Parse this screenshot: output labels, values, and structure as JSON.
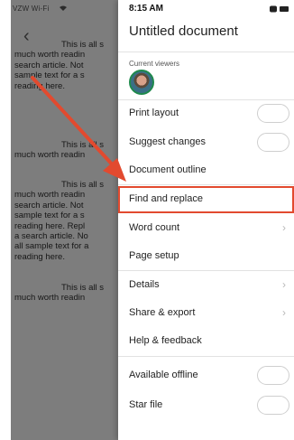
{
  "status": {
    "carrier": "VZW Wi-Fi",
    "time": "8:15 AM"
  },
  "document": {
    "paragraphs": [
      [
        "This is all s",
        "much worth readin",
        "search article. Not",
        "sample text for a s",
        "reading here."
      ],
      [
        "This is all s",
        "much worth readin"
      ],
      [
        "This is all s",
        "much worth readin",
        "search article. Not",
        "sample text for a s",
        "reading here. Repl",
        "a search article. No",
        "all sample text for a",
        "reading here."
      ],
      [
        "This is all s",
        "much worth readin"
      ]
    ]
  },
  "drawer": {
    "title": "Untitled document",
    "viewers_label": "Current viewers",
    "items": [
      {
        "label": "Print layout",
        "control": "toggle"
      },
      {
        "label": "Suggest changes",
        "control": "toggle"
      },
      {
        "label": "Document outline",
        "control": "none"
      },
      {
        "label": "Find and replace",
        "control": "none",
        "highlighted": true
      },
      {
        "label": "Word count",
        "control": "chevron"
      },
      {
        "label": "Page setup",
        "control": "none"
      },
      {
        "label": "Details",
        "control": "chevron"
      },
      {
        "label": "Share & export",
        "control": "chevron"
      },
      {
        "label": "Help & feedback",
        "control": "none"
      },
      {
        "label": "Available offline",
        "control": "toggle"
      },
      {
        "label": "Star file",
        "control": "toggle"
      }
    ]
  },
  "colors": {
    "highlight": "#e24a2f",
    "dim": "#7d7d7d"
  }
}
